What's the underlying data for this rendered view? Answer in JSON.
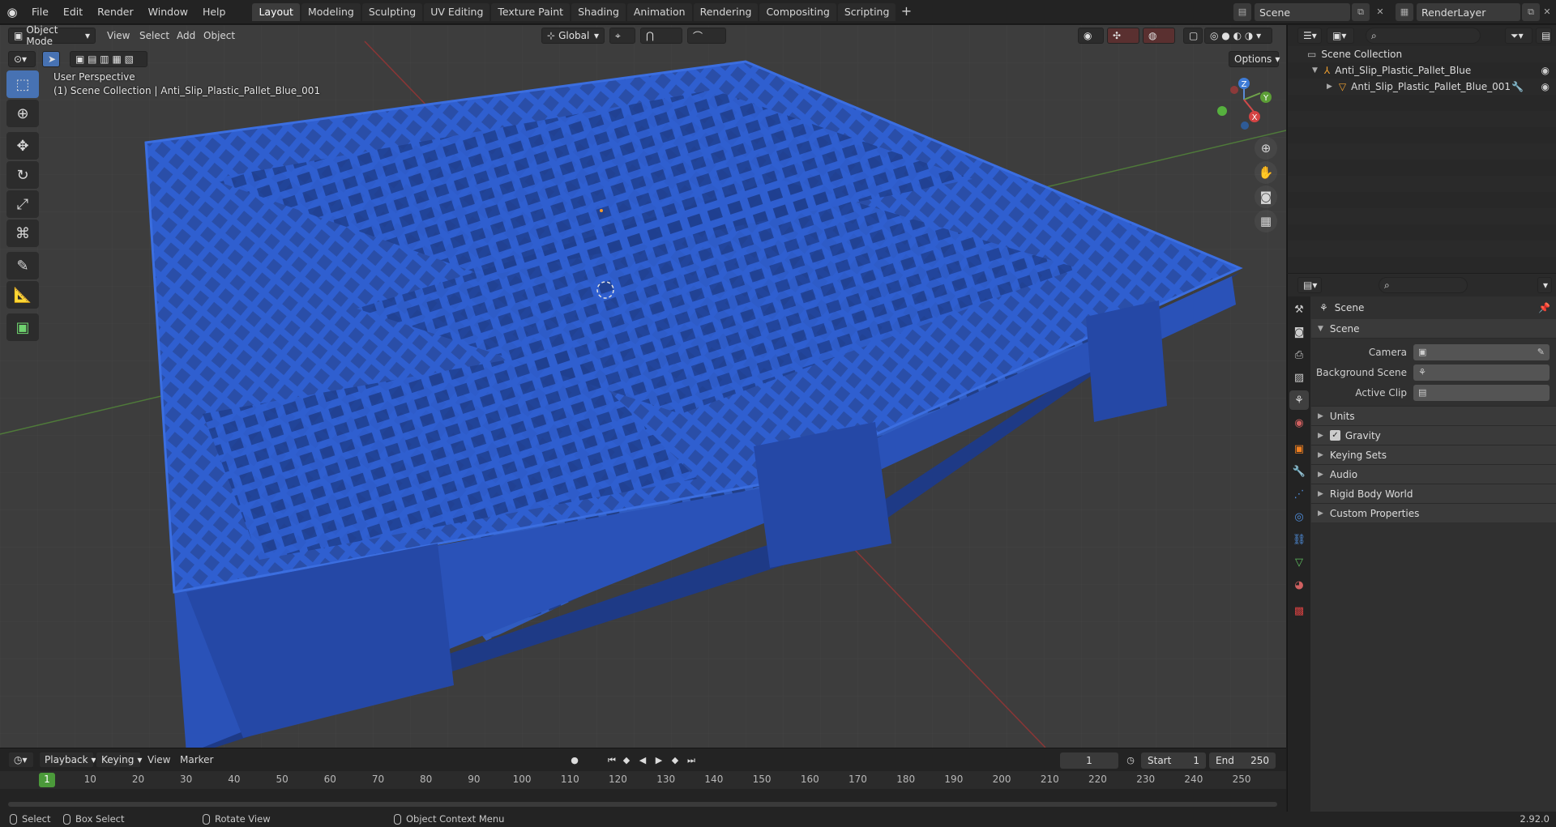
{
  "topbar": {
    "menus": [
      "File",
      "Edit",
      "Render",
      "Window",
      "Help"
    ],
    "workspaces": [
      "Layout",
      "Modeling",
      "Sculpting",
      "UV Editing",
      "Texture Paint",
      "Shading",
      "Animation",
      "Rendering",
      "Compositing",
      "Scripting"
    ],
    "active_workspace": "Layout",
    "scene_name": "Scene",
    "view_layer": "RenderLayer"
  },
  "viewport": {
    "mode": "Object Mode",
    "menus": [
      "View",
      "Select",
      "Add",
      "Object"
    ],
    "transform_orientation": "Global",
    "options_label": "Options",
    "perspective_label": "User Perspective",
    "collection_label": "(1) Scene Collection | Anti_Slip_Plastic_Pallet_Blue_001",
    "axis_labels": {
      "z": "Z",
      "y": "Y",
      "x": "X"
    },
    "object_color": "#2f5fd0"
  },
  "timeline": {
    "menus": {
      "playback": "Playback",
      "keying": "Keying",
      "view": "View",
      "marker": "Marker"
    },
    "current_frame": "1",
    "start_label": "Start",
    "start_value": "1",
    "end_label": "End",
    "end_value": "250",
    "ticks": [
      "1",
      "10",
      "20",
      "30",
      "40",
      "50",
      "60",
      "70",
      "80",
      "90",
      "100",
      "110",
      "120",
      "130",
      "140",
      "150",
      "160",
      "170",
      "180",
      "190",
      "200",
      "210",
      "220",
      "230",
      "240",
      "250"
    ]
  },
  "statusbar": {
    "select": "Select",
    "box_select": "Box Select",
    "rotate_view": "Rotate View",
    "context_menu": "Object Context Menu",
    "version": "2.92.0"
  },
  "outliner": {
    "root": "Scene Collection",
    "collection": "Anti_Slip_Plastic_Pallet_Blue",
    "object": "Anti_Slip_Plastic_Pallet_Blue_001"
  },
  "properties": {
    "header": "Scene",
    "panel": "Scene",
    "camera_label": "Camera",
    "background_scene_label": "Background Scene",
    "active_clip_label": "Active Clip",
    "sub_panels": [
      "Units",
      "Gravity",
      "Keying Sets",
      "Audio",
      "Rigid Body World",
      "Custom Properties"
    ]
  }
}
